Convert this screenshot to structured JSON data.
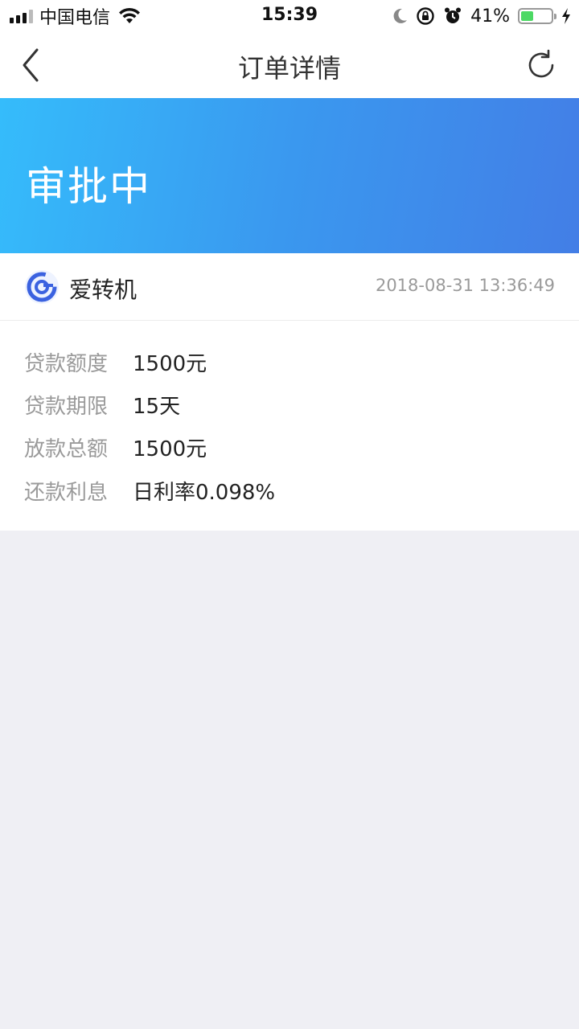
{
  "status_bar": {
    "carrier": "中国电信",
    "time": "15:39",
    "battery_percent": "41%",
    "battery_level": 0.41,
    "icons": [
      "signal-icon",
      "wifi-icon",
      "moon-icon",
      "rotation-lock-icon",
      "alarm-icon",
      "battery-icon",
      "charging-icon"
    ]
  },
  "nav": {
    "title": "订单详情",
    "back_icon": "chevron-left-icon",
    "refresh_icon": "refresh-icon"
  },
  "banner": {
    "status": "审批中",
    "colors": [
      "#35bcfb",
      "#437ee6"
    ]
  },
  "merchant": {
    "name": "爱转机",
    "timestamp": "2018-08-31 13:36:49",
    "logo_icon": "merchant-logo-icon"
  },
  "details": [
    {
      "label": "贷款额度",
      "value": "1500元"
    },
    {
      "label": "贷款期限",
      "value": "15天"
    },
    {
      "label": "放款总额",
      "value": "1500元"
    },
    {
      "label": "还款利息",
      "value": "日利率0.098%"
    }
  ]
}
